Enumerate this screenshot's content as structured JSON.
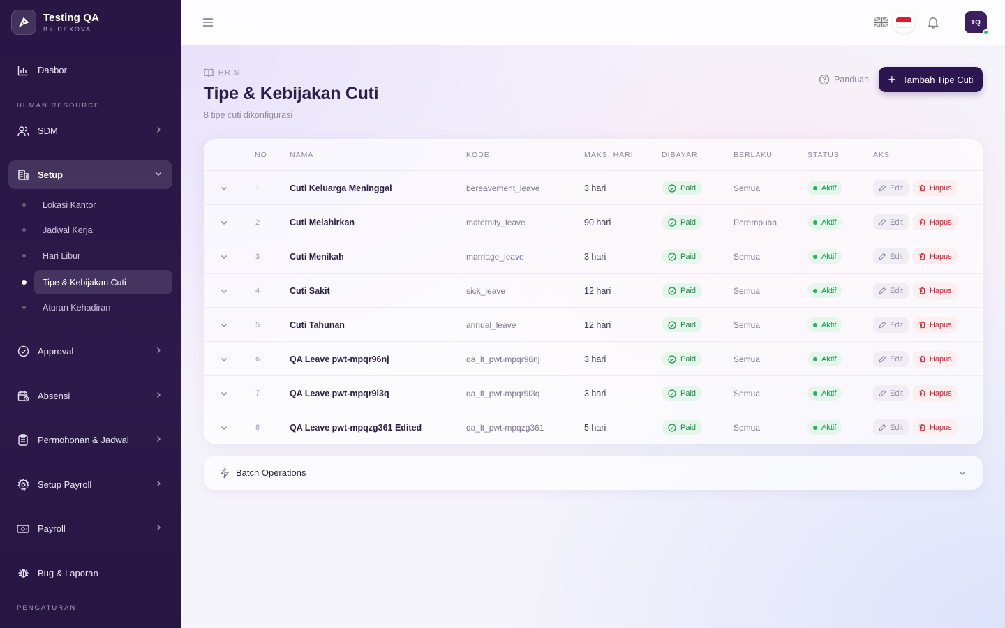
{
  "brand": {
    "title": "Testing QA",
    "subtitle": "BY DEXOVA"
  },
  "sidebar": {
    "dashboard": "Dasbor",
    "section_hr": "HUMAN RESOURCE",
    "sdm": "SDM",
    "setup": "Setup",
    "setup_children": [
      "Lokasi Kantor",
      "Jadwal Kerja",
      "Hari Libur",
      "Tipe & Kebijakan Cuti",
      "Aturan Kehadiran"
    ],
    "approval": "Approval",
    "absensi": "Absensi",
    "permohonan": "Permohonan & Jadwal",
    "setup_payroll": "Setup Payroll",
    "payroll": "Payroll",
    "bug": "Bug & Laporan",
    "section_settings": "PENGATURAN"
  },
  "topbar": {
    "avatar": "TQ"
  },
  "page": {
    "breadcrumb": "HRIS",
    "title": "Tipe & Kebijakan Cuti",
    "subtitle": "8 tipe cuti dikonfigurasi",
    "guide": "Panduan",
    "add_button": "Tambah Tipe Cuti"
  },
  "table": {
    "headers": [
      "NO",
      "NAMA",
      "KODE",
      "MAKS. HARI",
      "DIBAYAR",
      "BERLAKU",
      "STATUS",
      "AKSI"
    ],
    "paid_label": "Paid",
    "status_label": "Aktif",
    "edit_label": "Edit",
    "delete_label": "Hapus",
    "rows": [
      {
        "no": "1",
        "name": "Cuti Keluarga Meninggal",
        "code": "bereavement_leave",
        "max": "3 hari",
        "applies": "Semua"
      },
      {
        "no": "2",
        "name": "Cuti Melahirkan",
        "code": "maternity_leave",
        "max": "90 hari",
        "applies": "Perempuan"
      },
      {
        "no": "3",
        "name": "Cuti Menikah",
        "code": "marriage_leave",
        "max": "3 hari",
        "applies": "Semua"
      },
      {
        "no": "4",
        "name": "Cuti Sakit",
        "code": "sick_leave",
        "max": "12 hari",
        "applies": "Semua"
      },
      {
        "no": "5",
        "name": "Cuti Tahunan",
        "code": "annual_leave",
        "max": "12 hari",
        "applies": "Semua"
      },
      {
        "no": "6",
        "name": "QA Leave pwt-mpqr96nj",
        "code": "qa_lt_pwt-mpqr96nj",
        "max": "3 hari",
        "applies": "Semua"
      },
      {
        "no": "7",
        "name": "QA Leave pwt-mpqr9l3q",
        "code": "qa_lt_pwt-mpqr9l3q",
        "max": "3 hari",
        "applies": "Semua"
      },
      {
        "no": "8",
        "name": "QA Leave pwt-mpqzg361 Edited",
        "code": "qa_lt_pwt-mpqzg361",
        "max": "5 hari",
        "applies": "Semua"
      }
    ]
  },
  "batch": {
    "label": "Batch Operations"
  }
}
